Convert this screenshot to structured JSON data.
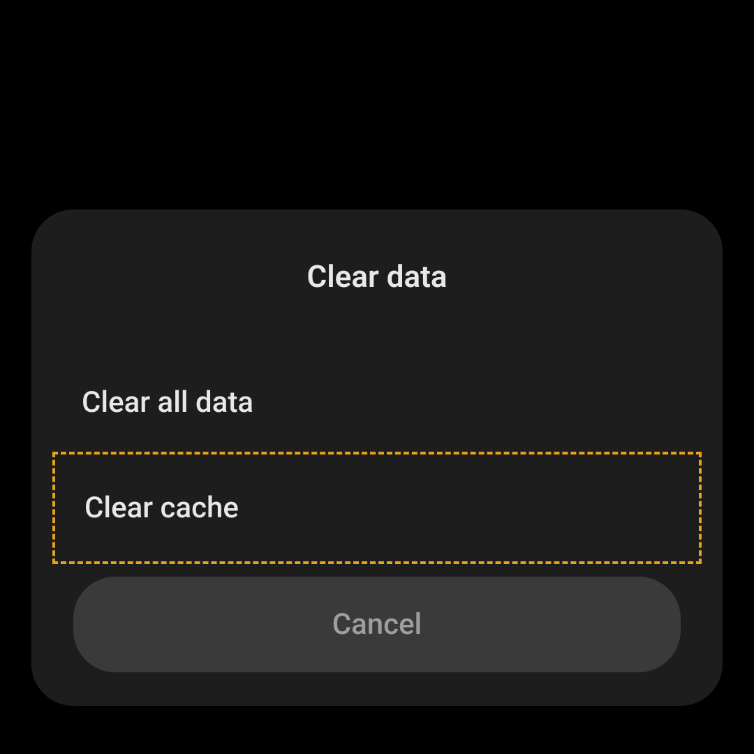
{
  "dialog": {
    "title": "Clear data",
    "options": [
      "Clear all data",
      "Clear cache"
    ],
    "cancel_label": "Cancel",
    "highlight_color": "#e6a219"
  }
}
